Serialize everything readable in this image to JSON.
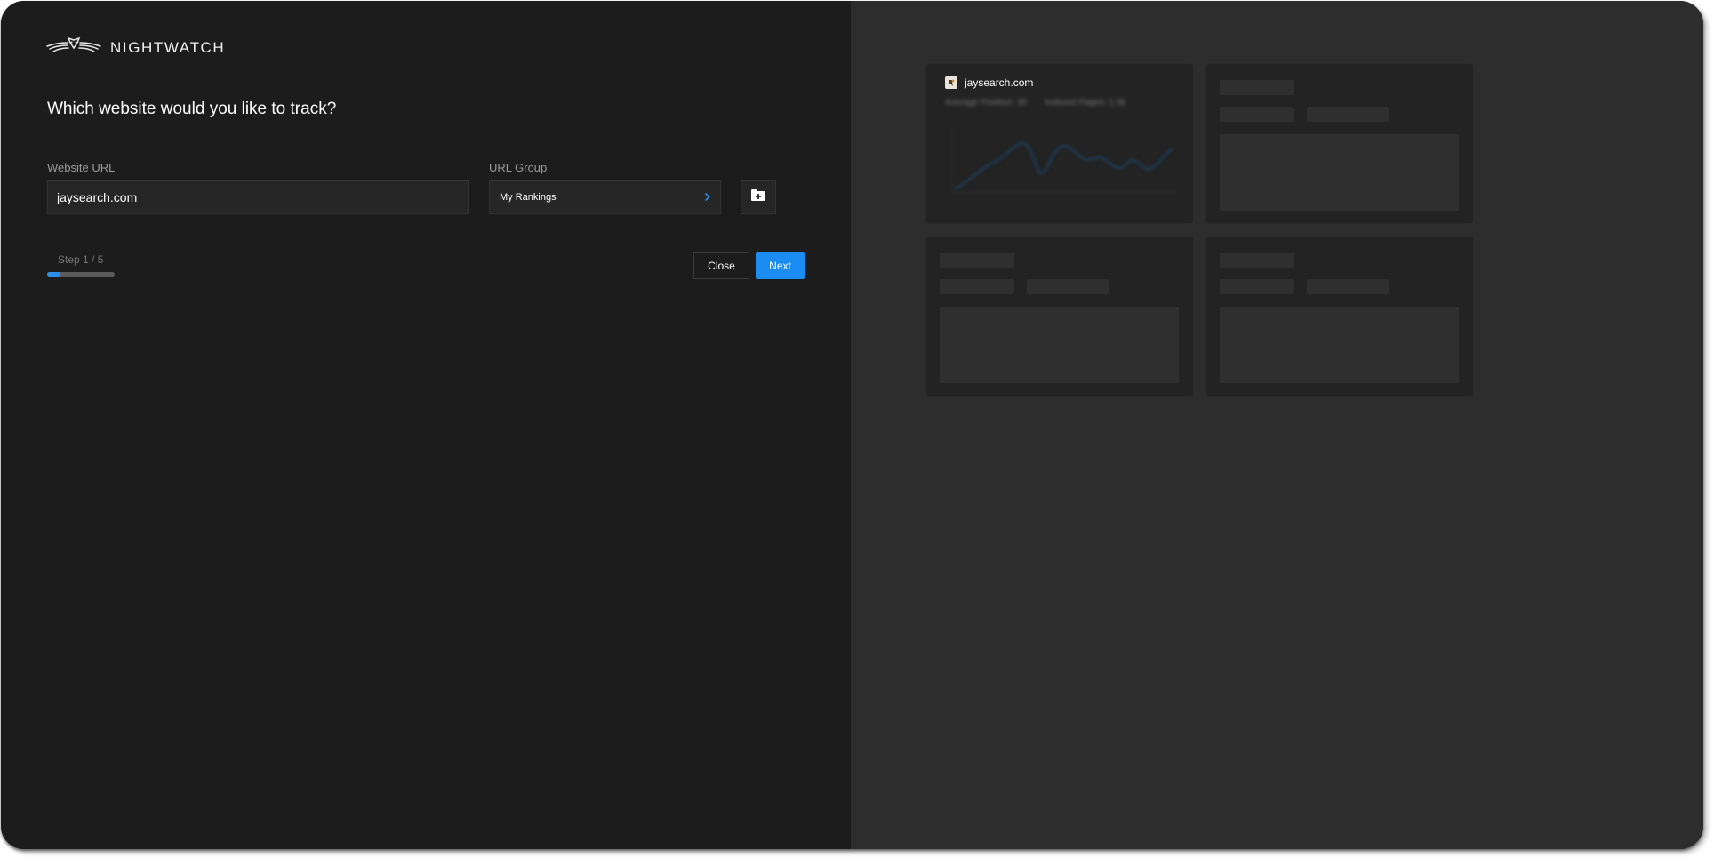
{
  "brand": {
    "name": "NIGHTWATCH",
    "logo_icon": "owl-wings-logo"
  },
  "wizard": {
    "heading": "Which website would you like to track?",
    "url_field": {
      "label": "Website URL",
      "value": "jaysearch.com"
    },
    "group_field": {
      "label": "URL Group",
      "value": "My Rankings",
      "icon": "chevron-right-icon"
    },
    "add_group_icon": "folder-plus-icon",
    "step": {
      "text": "Step 1 / 5",
      "current": 1,
      "total": 5,
      "progress_fraction": 0.2
    },
    "buttons": {
      "close": "Close",
      "next": "Next"
    }
  },
  "preview": {
    "site_card": {
      "site_name": "jaysearch.com",
      "favicon_icon": "site-favicon",
      "stats": [
        "Average Position: 30",
        "Indexed Pages: 1.5k"
      ]
    }
  },
  "colors": {
    "accent": "#1b8cf2",
    "left_panel": "#1c1c1c",
    "right_panel": "#2d2d2d",
    "chart_line": "#1f3a52"
  }
}
